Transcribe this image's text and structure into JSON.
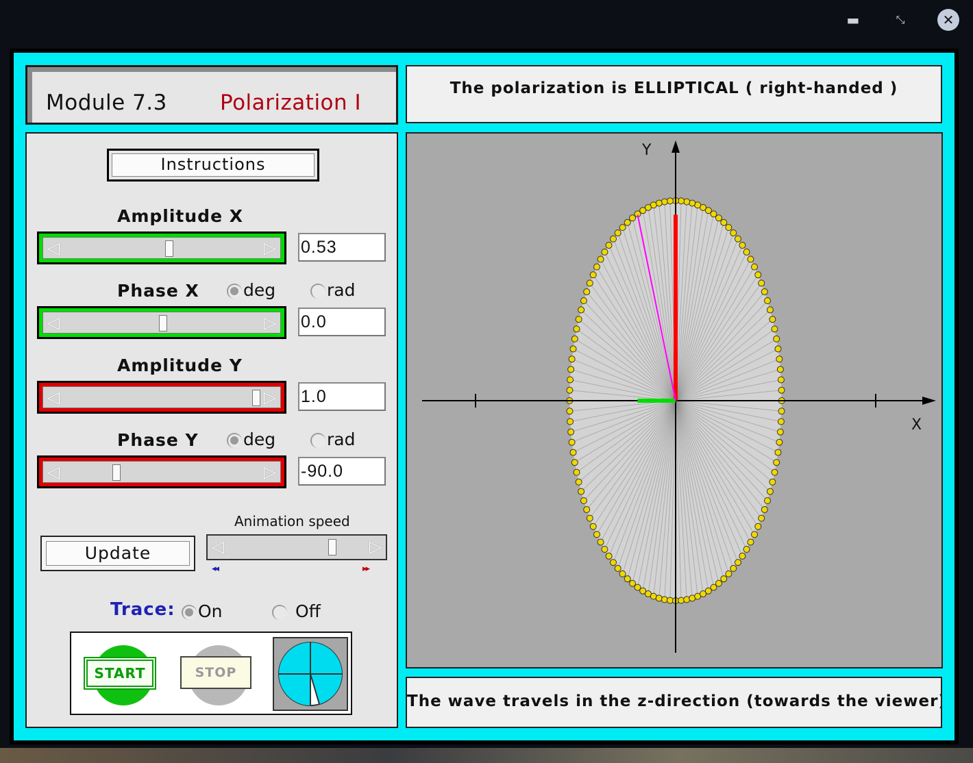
{
  "window": {
    "minimize_icon": "minimize-icon",
    "maximize_icon": "restore-icon",
    "close_icon": "close-icon",
    "minimize_glyph": "▬",
    "maximize_glyph": "⤡",
    "close_glyph": "✕"
  },
  "header": {
    "module": "Module 7.3",
    "title": "Polarization  I"
  },
  "status": "The polarization is ELLIPTICAL ( right-handed )",
  "footer": "The wave travels in the z-direction (towards the viewer)",
  "controls": {
    "instructions_label": "Instructions",
    "amp_x": {
      "label": "Amplitude X",
      "value": "0.53",
      "level": 0.53
    },
    "phase_x": {
      "label": "Phase X",
      "value": "0.0",
      "level": 0.5,
      "unit_options": [
        "deg",
        "rad"
      ],
      "selected_unit": "deg"
    },
    "amp_y": {
      "label": "Amplitude Y",
      "value": "1.0",
      "level": 1.0
    },
    "phase_y": {
      "label": "Phase Y",
      "value": "-90.0",
      "level": 0.25,
      "unit_options": [
        "deg",
        "rad"
      ],
      "selected_unit": "deg"
    },
    "update_label": "Update",
    "animation_speed_label": "Animation speed",
    "animation_speed_level": 0.83,
    "slower_glyph": "◂◂",
    "faster_glyph": "▸▸",
    "trace_label": "Trace:",
    "trace_options": [
      "On",
      "Off"
    ],
    "trace_selected": "On",
    "start_label": "START",
    "stop_label": "STOP",
    "arrow_left": "◁",
    "arrow_right": "▷"
  },
  "plot": {
    "x_label": "X",
    "y_label": "Y",
    "amplitude_x": 0.53,
    "amplitude_y": 1.0,
    "phase_x_deg": 0.0,
    "phase_y_deg": -90.0,
    "colors": {
      "background": "#a9a9a9",
      "ellipse_fill": "#d3d3d3",
      "trace_dots": "#f0d800",
      "y_component": "#ff0000",
      "x_component": "#00dd00",
      "field_vector": "#ff00ff"
    }
  },
  "colors": {
    "frame": "#00ecf4",
    "x_slider": "#00dd00",
    "y_slider": "#e00000",
    "title_accent": "#b00010",
    "trace_label": "#1c22b4"
  }
}
